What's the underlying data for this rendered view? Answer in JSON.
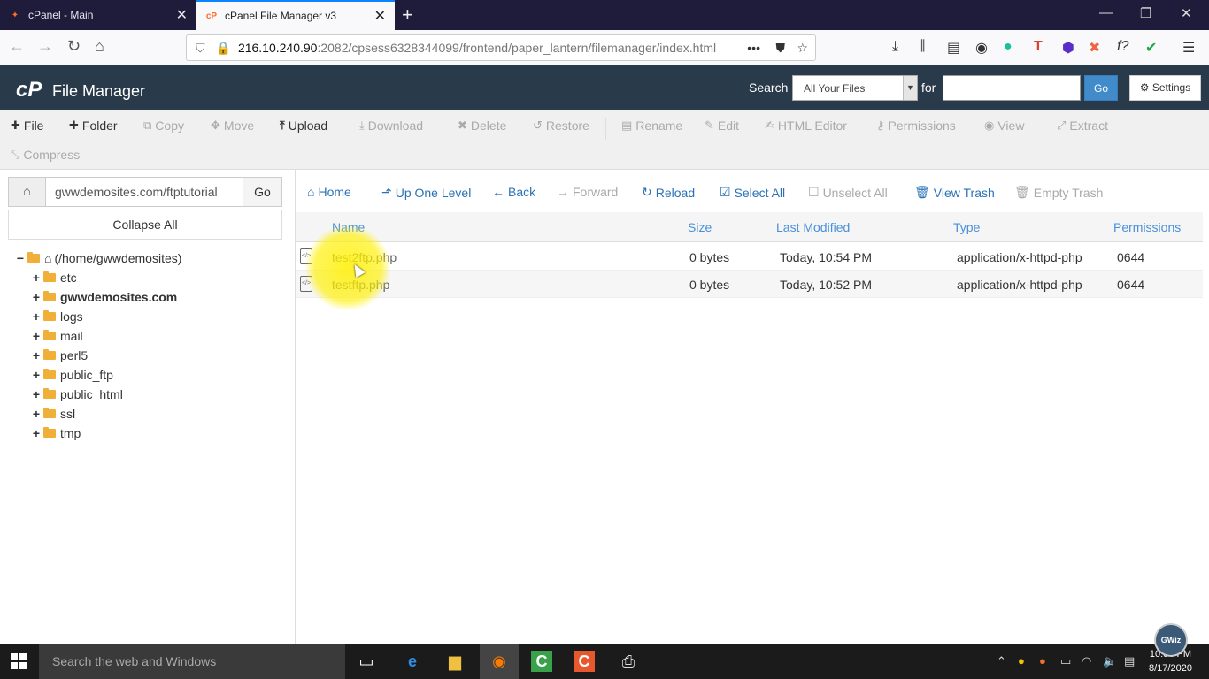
{
  "browser": {
    "tabs": [
      {
        "title": "cPanel - Main",
        "active": false
      },
      {
        "title": "cPanel File Manager v3",
        "active": true
      }
    ],
    "url_host": "216.10.240.90",
    "url_rest": ":2082/cpsess6328344099/frontend/paper_lantern/filemanager/index.html"
  },
  "header": {
    "logo": "cP",
    "title": "File Manager",
    "search_label": "Search",
    "search_scope": "All Your Files",
    "for_label": "for",
    "go_label": "Go",
    "settings_label": "Settings"
  },
  "toolbar": [
    {
      "label": "File",
      "icon": "plus-icon",
      "enabled": true
    },
    {
      "label": "Folder",
      "icon": "plus-icon",
      "enabled": true
    },
    {
      "label": "Copy",
      "icon": "copy-icon",
      "enabled": false
    },
    {
      "label": "Move",
      "icon": "move-icon",
      "enabled": false
    },
    {
      "label": "Upload",
      "icon": "upload-icon",
      "enabled": true
    },
    {
      "label": "Download",
      "icon": "download-icon",
      "enabled": false
    },
    {
      "label": "Delete",
      "icon": "delete-icon",
      "enabled": false
    },
    {
      "label": "Restore",
      "icon": "restore-icon",
      "enabled": false
    },
    {
      "label": "Rename",
      "icon": "rename-icon",
      "enabled": false
    },
    {
      "label": "Edit",
      "icon": "pencil-icon",
      "enabled": false
    },
    {
      "label": "HTML Editor",
      "icon": "html-editor-icon",
      "enabled": false
    },
    {
      "label": "Permissions",
      "icon": "key-icon",
      "enabled": false
    },
    {
      "label": "View",
      "icon": "eye-icon",
      "enabled": false
    },
    {
      "label": "Extract",
      "icon": "extract-icon",
      "enabled": false
    },
    {
      "label": "Compress",
      "icon": "compress-icon",
      "enabled": false
    }
  ],
  "sidebar": {
    "path_value": "gwwdemosites.com/ftptutorial",
    "go_label": "Go",
    "collapse_label": "Collapse All",
    "root": "(/home/gwwdemosites)",
    "folders": [
      {
        "name": "etc",
        "bold": false
      },
      {
        "name": "gwwdemosites.com",
        "bold": true
      },
      {
        "name": "logs",
        "bold": false
      },
      {
        "name": "mail",
        "bold": false
      },
      {
        "name": "perl5",
        "bold": false
      },
      {
        "name": "public_ftp",
        "bold": false
      },
      {
        "name": "public_html",
        "bold": false
      },
      {
        "name": "ssl",
        "bold": false
      },
      {
        "name": "tmp",
        "bold": false
      }
    ]
  },
  "nav": [
    {
      "label": "Home",
      "enabled": true
    },
    {
      "label": "Up One Level",
      "enabled": true
    },
    {
      "label": "Back",
      "enabled": true
    },
    {
      "label": "Forward",
      "enabled": false
    },
    {
      "label": "Reload",
      "enabled": true
    },
    {
      "label": "Select All",
      "enabled": true
    },
    {
      "label": "Unselect All",
      "enabled": false
    },
    {
      "label": "View Trash",
      "enabled": true
    },
    {
      "label": "Empty Trash",
      "enabled": false
    }
  ],
  "table": {
    "columns": [
      "Name",
      "Size",
      "Last Modified",
      "Type",
      "Permissions"
    ],
    "rows": [
      {
        "name": "test2ftp.php",
        "size": "0 bytes",
        "modified": "Today, 10:54 PM",
        "type": "application/x-httpd-php",
        "perms": "0644"
      },
      {
        "name": "testftp.php",
        "size": "0 bytes",
        "modified": "Today, 10:52 PM",
        "type": "application/x-httpd-php",
        "perms": "0644"
      }
    ]
  },
  "taskbar": {
    "search_placeholder": "Search the web and Windows",
    "time": "10:54 PM",
    "date": "8/17/2020"
  },
  "watermark": "GWiz"
}
